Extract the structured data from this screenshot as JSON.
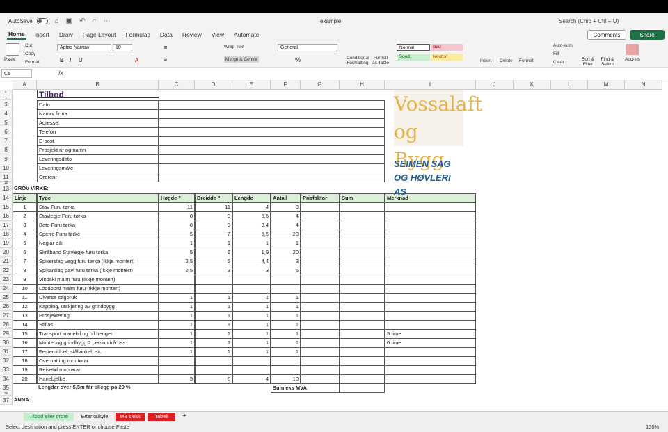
{
  "titlebar": {
    "autosave": "AutoSave",
    "doc": "example",
    "search": "Search (Cmd + Ctrl + U)"
  },
  "tabs": [
    "Home",
    "Insert",
    "Draw",
    "Page Layout",
    "Formulas",
    "Data",
    "Review",
    "View",
    "Automate"
  ],
  "buttons": {
    "comments": "Comments",
    "share": "Share"
  },
  "ribbon": {
    "paste": "Paste",
    "cut": "Cut",
    "copy": "Copy",
    "format": "Format",
    "font": "Aptos Narrow",
    "size": "10",
    "wrap": "Wrap Text",
    "merge": "Merge & Centre",
    "numfmt": "General",
    "cond": "Conditional Formatting",
    "fmt_table": "Format as Table",
    "normal": "Normal",
    "bad": "Bad",
    "good": "Good",
    "neutral": "Neutral",
    "insert": "Insert",
    "delete": "Delete",
    "format2": "Format",
    "autosum": "Auto-sum",
    "fill": "Fill",
    "clear": "Clear",
    "sort": "Sort & Filter",
    "find": "Find & Select",
    "addins": "Add-ins"
  },
  "namebox": "C5",
  "fx": "fx",
  "columns": [
    "A",
    "B",
    "C",
    "D",
    "E",
    "F",
    "G",
    "H",
    "I",
    "J",
    "K",
    "L",
    "M",
    "N"
  ],
  "rows": [
    "1",
    "2",
    "3",
    "4",
    "5",
    "6",
    "7",
    "8",
    "9",
    "10",
    "11",
    "12",
    "13",
    "14",
    "15",
    "16",
    "17",
    "18",
    "19",
    "20",
    "21",
    "22",
    "23",
    "24",
    "25",
    "26",
    "27",
    "28",
    "29",
    "30",
    "31",
    "32",
    "33",
    "34",
    "35",
    "36",
    "37"
  ],
  "header": {
    "title": "Tilbod",
    "fields": [
      "Dato",
      "Namn/ firma",
      "Adresse:",
      "Telefon",
      "E-post",
      "Prosjekt nr og namn",
      "Leveringsdato",
      "Leveringsmåte",
      "Ordrenr"
    ]
  },
  "grov": "GROV VIRKE:",
  "table_head": [
    "Linje",
    "Type",
    "Høgde \"",
    "Breidde \"",
    "Lengde",
    "Antall",
    "Prisfaktor",
    "Sum",
    "Merknad"
  ],
  "items": [
    [
      "1",
      "Stav Furu tørka",
      "11",
      "11",
      "4",
      "8",
      ""
    ],
    [
      "2",
      "Stavlegje Furu tørka",
      "8",
      "9",
      "5,5",
      "4",
      ""
    ],
    [
      "3",
      "Bete Furu tørka",
      "8",
      "9",
      "8,4",
      "4",
      ""
    ],
    [
      "4",
      "Sperre Furu tørke",
      "5",
      "7",
      "5,5",
      "20",
      ""
    ],
    [
      "5",
      "Naglar eik",
      "1",
      "1",
      "1",
      "1",
      ""
    ],
    [
      "6",
      "Skråband Stavlegje  furu tørka",
      "5",
      "6",
      "1,9",
      "20",
      ""
    ],
    [
      "7",
      "Spikerslag vegg furu tørka  (Ikkje montert)",
      "2,5",
      "5",
      "4,4",
      "3",
      ""
    ],
    [
      "8",
      "Spikarslag gavl furu tørka  (Ikkje montert)",
      "2,5",
      "3",
      "3",
      "6",
      ""
    ],
    [
      "9",
      "Vindski malm furu  (Ikkje montert)",
      "",
      "",
      "",
      "",
      ""
    ],
    [
      "10",
      "Loddbord malm furu  (Ikkje montert)",
      "",
      "",
      "",
      "",
      ""
    ],
    [
      "11",
      "Diverse sagbruk",
      "1",
      "1",
      "1",
      "1",
      ""
    ],
    [
      "12",
      "Kapping, utskjering  av grindbygg",
      "1",
      "1",
      "1",
      "1",
      ""
    ],
    [
      "13",
      "Prosjektering",
      "1",
      "1",
      "1",
      "1",
      ""
    ],
    [
      "14",
      "Stillas",
      "1",
      "1",
      "1",
      "1",
      ""
    ],
    [
      "15",
      "Transport kranebil og bil henger",
      "1",
      "1",
      "1",
      "1",
      "5 time"
    ],
    [
      "16",
      "Montering grindbygg 2 person frå oss",
      "1",
      "1",
      "1",
      "1",
      "6 time"
    ],
    [
      "17",
      "Festemiddel, stålvinkel, etc",
      "1",
      "1",
      "1",
      "1",
      ""
    ],
    [
      "18",
      "Overnatting montørar",
      "",
      "",
      "",
      "",
      ""
    ],
    [
      "19",
      "Reisetid montørar",
      "",
      "",
      "",
      "",
      ""
    ],
    [
      "20",
      "Hanebjelke",
      "5",
      "6",
      "4",
      "10",
      ""
    ]
  ],
  "note": "Lengder over 5,5m får tillegg på 20 %",
  "sum_label": "Sum eks MVA",
  "anna": "ANNA:",
  "logo1": [
    "Vossalaft",
    "og Bygg"
  ],
  "logo2": [
    "SEIMEN SAG",
    "OG HØVLERI AS"
  ],
  "sheets": [
    "Tilbod eller ordre",
    "Etterkalkyle",
    "M3 sjekk",
    "Tabell"
  ],
  "status": "Select destination and press ENTER or choose Paste",
  "zoom": "150%"
}
